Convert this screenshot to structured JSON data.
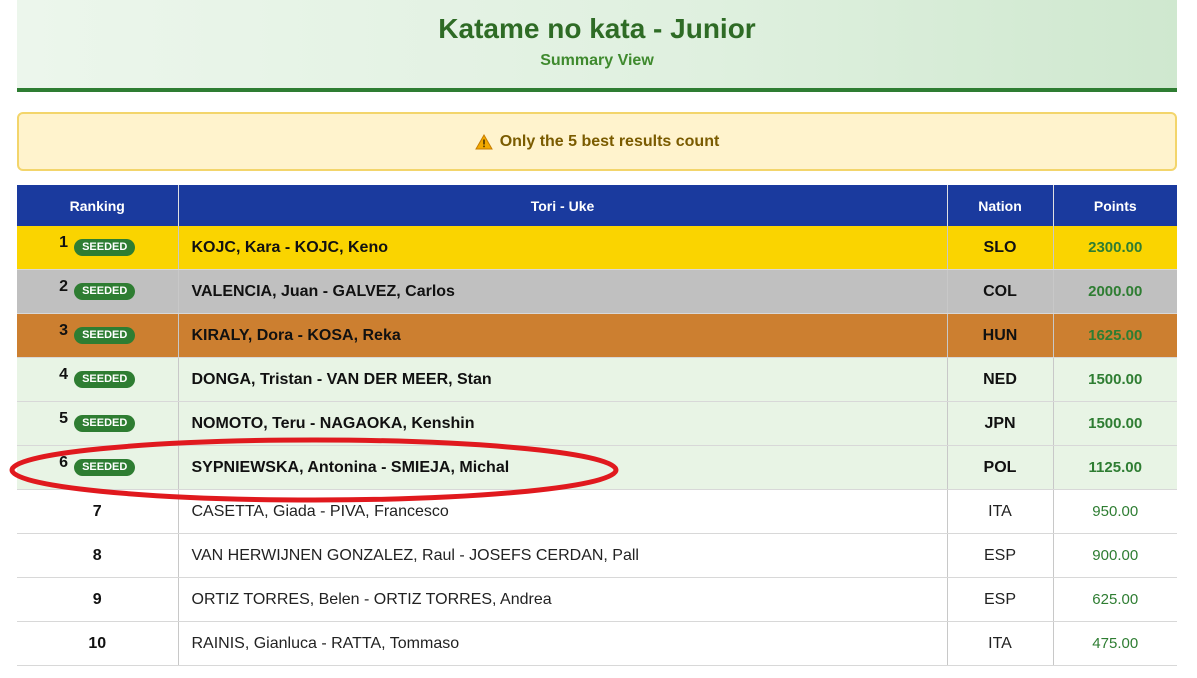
{
  "header": {
    "title": "Katame no kata - Junior",
    "subtitle": "Summary View"
  },
  "notice": {
    "icon": "warning-icon",
    "text": "Only the 5 best results count"
  },
  "table": {
    "columns": [
      "Ranking",
      "Tori - Uke",
      "Nation",
      "Points"
    ],
    "rows": [
      {
        "rank": "1",
        "badge": "SEEDED",
        "names": "KOJC, Kara - KOJC, Keno",
        "nation": "SLO",
        "points": "2300.00"
      },
      {
        "rank": "2",
        "badge": "SEEDED",
        "names": "VALENCIA, Juan - GALVEZ, Carlos",
        "nation": "COL",
        "points": "2000.00"
      },
      {
        "rank": "3",
        "badge": "SEEDED",
        "names": "KIRALY, Dora - KOSA, Reka",
        "nation": "HUN",
        "points": "1625.00"
      },
      {
        "rank": "4",
        "badge": "SEEDED",
        "names": "DONGA, Tristan - VAN DER MEER, Stan",
        "nation": "NED",
        "points": "1500.00"
      },
      {
        "rank": "5",
        "badge": "SEEDED",
        "names": "NOMOTO, Teru - NAGAOKA, Kenshin",
        "nation": "JPN",
        "points": "1500.00"
      },
      {
        "rank": "6",
        "badge": "SEEDED",
        "names": "SYPNIEWSKA, Antonina - SMIEJA, Michal",
        "nation": "POL",
        "points": "1125.00"
      },
      {
        "rank": "7",
        "names": "CASETTA, Giada - PIVA, Francesco",
        "nation": "ITA",
        "points": "950.00"
      },
      {
        "rank": "8",
        "names": "VAN HERWIJNEN GONZALEZ, Raul - JOSEFS CERDAN, Pall",
        "nation": "ESP",
        "points": "900.00"
      },
      {
        "rank": "9",
        "names": "ORTIZ TORRES, Belen - ORTIZ TORRES, Andrea",
        "nation": "ESP",
        "points": "625.00"
      },
      {
        "rank": "10",
        "names": "RAINIS, Gianluca - RATTA, Tommaso",
        "nation": "ITA",
        "points": "475.00"
      }
    ]
  },
  "colors": {
    "header_green": "#2e6b25",
    "table_header": "#1a3a9e",
    "gold": "#fad400",
    "silver": "#c0c0c0",
    "bronze": "#cc7f30",
    "seeded_row": "#e8f4e5",
    "annotation": "#e0191e"
  }
}
